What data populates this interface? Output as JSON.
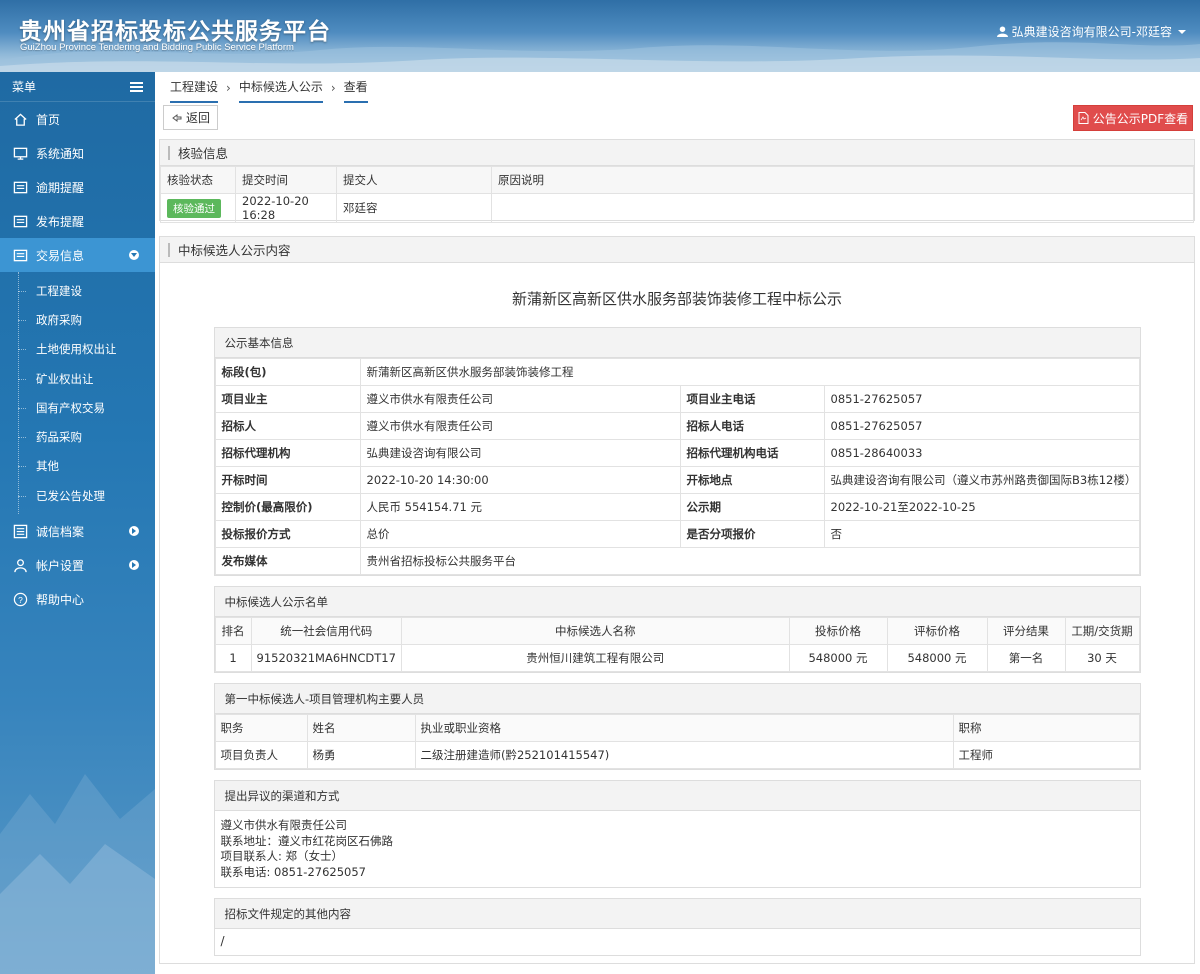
{
  "header": {
    "title": "贵州省招标投标公共服务平台",
    "subtitle": "GuiZhou Province Tendering and Bidding Public Service Platform",
    "user": "弘典建设咨询有限公司-邓廷容"
  },
  "sidebar": {
    "menu_label": "菜单",
    "items": [
      {
        "label": "首页",
        "icon": "home-icon"
      },
      {
        "label": "系统通知",
        "icon": "monitor-icon"
      },
      {
        "label": "逾期提醒",
        "icon": "list-icon"
      },
      {
        "label": "发布提醒",
        "icon": "list-icon"
      },
      {
        "label": "交易信息",
        "icon": "list-icon",
        "active": true
      }
    ],
    "sub_items": [
      "工程建设",
      "政府采购",
      "土地使用权出让",
      "矿业权出让",
      "国有产权交易",
      "药品采购",
      "其他",
      "已发公告处理"
    ],
    "bottom_items": [
      {
        "label": "诚信档案",
        "icon": "grid-icon"
      },
      {
        "label": "帐户设置",
        "icon": "user-icon"
      },
      {
        "label": "帮助中心",
        "icon": "help-icon"
      }
    ]
  },
  "breadcrumb": [
    "工程建设",
    "中标候选人公示",
    "查看"
  ],
  "toolbar": {
    "back_label": "返回",
    "pdf_label": "公告公示PDF查看"
  },
  "verify": {
    "title": "核验信息",
    "columns": [
      "核验状态",
      "提交时间",
      "提交人",
      "原因说明"
    ],
    "row": {
      "status": "核验通过",
      "time": "2022-10-20 16:28",
      "submitter": "邓廷容",
      "reason": ""
    }
  },
  "content": {
    "panel_title": "中标候选人公示内容",
    "doc_title": "新蒲新区高新区供水服务部装饰装修工程中标公示",
    "basic": {
      "title": "公示基本信息",
      "section_label": "标段(包)",
      "section_value": "新蒲新区高新区供水服务部装饰装修工程",
      "rows": [
        {
          "k1": "项目业主",
          "v1": "遵义市供水有限责任公司",
          "k2": "项目业主电话",
          "v2": "0851-27625057"
        },
        {
          "k1": "招标人",
          "v1": "遵义市供水有限责任公司",
          "k2": "招标人电话",
          "v2": "0851-27625057"
        },
        {
          "k1": "招标代理机构",
          "v1": "弘典建设咨询有限公司",
          "k2": "招标代理机构电话",
          "v2": "0851-28640033"
        },
        {
          "k1": "开标时间",
          "v1": "2022-10-20 14:30:00",
          "k2": "开标地点",
          "v2": "弘典建设咨询有限公司（遵义市苏州路贵御国际B3栋12楼）"
        },
        {
          "k1": "控制价(最高限价)",
          "v1": "人民币 554154.71 元",
          "k2": "公示期",
          "v2": "2022-10-21至2022-10-25"
        },
        {
          "k1": "投标报价方式",
          "v1": "总价",
          "k2": "是否分项报价",
          "v2": "否"
        }
      ],
      "media_label": "发布媒体",
      "media_value": "贵州省招标投标公共服务平台"
    },
    "candidates": {
      "title": "中标候选人公示名单",
      "columns": [
        "排名",
        "统一社会信用代码",
        "中标候选人名称",
        "投标价格",
        "评标价格",
        "评分结果",
        "工期/交货期"
      ],
      "rows": [
        {
          "rank": "1",
          "code": "91520321MA6HNCDT17",
          "name": "贵州恒川建筑工程有限公司",
          "bid": "548000 元",
          "eval": "548000 元",
          "result": "第一名",
          "period": "30 天"
        }
      ]
    },
    "staff": {
      "title": "第一中标候选人-项目管理机构主要人员",
      "columns": [
        "职务",
        "姓名",
        "执业或职业资格",
        "职称"
      ],
      "rows": [
        {
          "role": "项目负责人",
          "name": "杨勇",
          "qual": "二级注册建造师(黔252101415547)",
          "title": "工程师"
        }
      ]
    },
    "objection": {
      "title": "提出异议的渠道和方式",
      "lines": [
        "遵义市供水有限责任公司",
        "联系地址：遵义市红花岗区石佛路",
        "项目联系人: 郑（女士）",
        "联系电话: 0851-27625057"
      ]
    },
    "other": {
      "title": "招标文件规定的其他内容",
      "value": "/"
    }
  }
}
